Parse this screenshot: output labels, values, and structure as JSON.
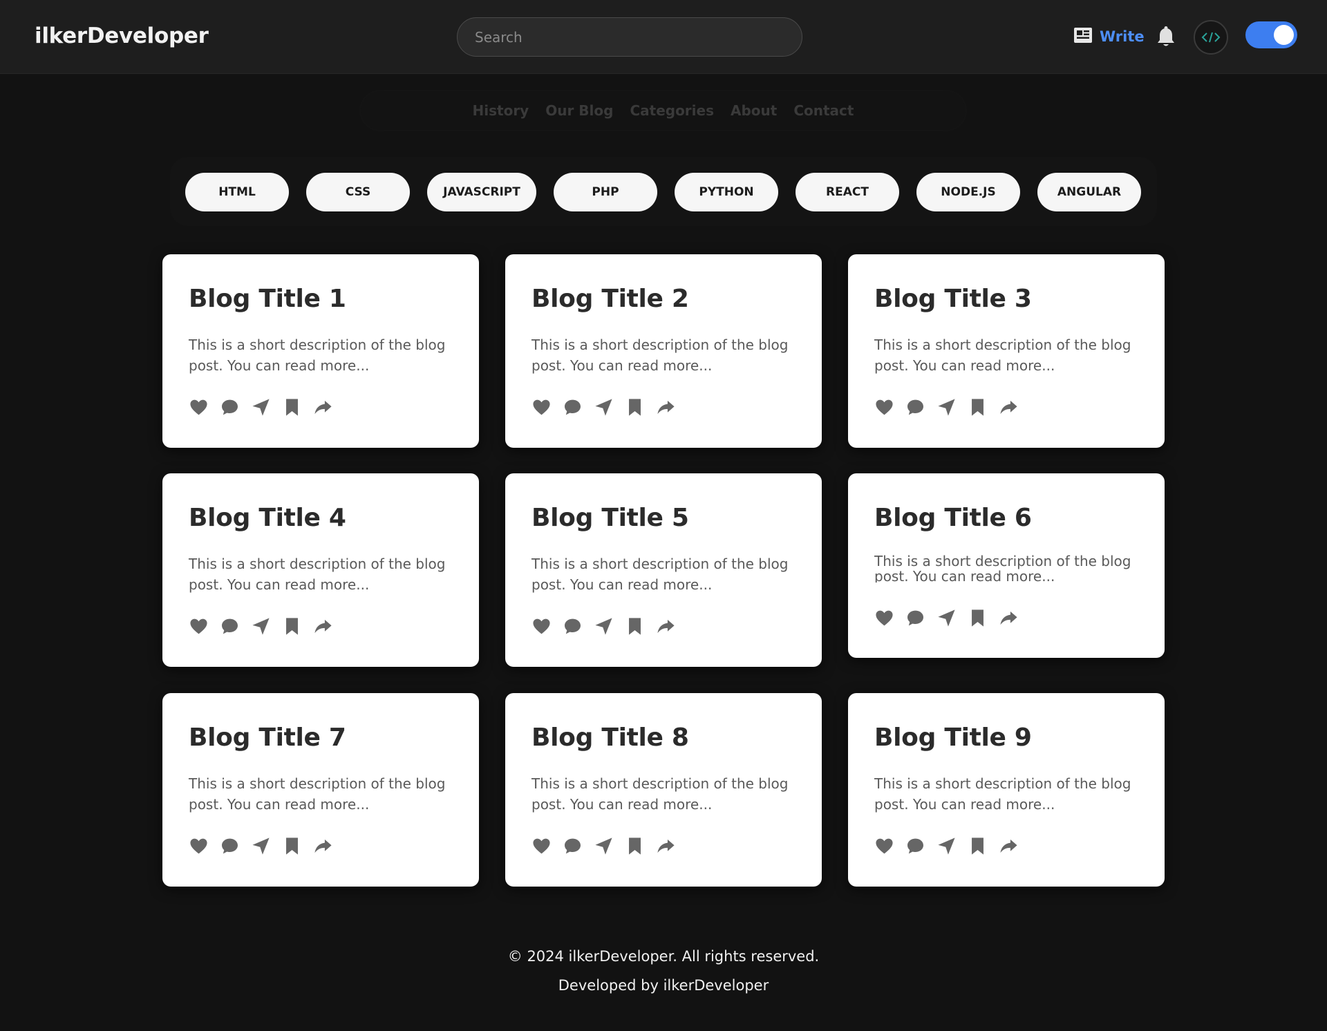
{
  "header": {
    "logo": "ilkerDeveloper",
    "search_placeholder": "Search",
    "write_label": "Write",
    "icons": {
      "write": "newspaper-icon",
      "notifications": "bell-icon",
      "avatar": "code-logo-avatar",
      "theme": "toggle-switch"
    },
    "accent_color": "#4d8ef7"
  },
  "nav": {
    "items": [
      {
        "label": "History"
      },
      {
        "label": "Our Blog"
      },
      {
        "label": "Categories"
      },
      {
        "label": "About"
      },
      {
        "label": "Contact"
      }
    ]
  },
  "tags": [
    "HTML",
    "CSS",
    "JAVASCRIPT",
    "PHP",
    "PYTHON",
    "REACT",
    "NODE.JS",
    "ANGULAR"
  ],
  "cards": [
    {
      "title": "Blog Title 1",
      "description": "This is a short description of the blog post. You can read more..."
    },
    {
      "title": "Blog Title 2",
      "description": "This is a short description of the blog post. You can read more..."
    },
    {
      "title": "Blog Title 3",
      "description": "This is a short description of the blog post. You can read more..."
    },
    {
      "title": "Blog Title 4",
      "description": "This is a short description of the blog post. You can read more..."
    },
    {
      "title": "Blog Title 5",
      "description": "This is a short description of the blog post. You can read more..."
    },
    {
      "title": "Blog Title 6",
      "description": "This is a short description of the blog post. You can read more..."
    },
    {
      "title": "Blog Title 7",
      "description": "This is a short description of the blog post. You can read more..."
    },
    {
      "title": "Blog Title 8",
      "description": "This is a short description of the blog post. You can read more..."
    },
    {
      "title": "Blog Title 9",
      "description": "This is a short description of the blog post. You can read more..."
    }
  ],
  "card_actions": [
    "heart-icon",
    "comment-icon",
    "send-icon",
    "bookmark-icon",
    "share-icon"
  ],
  "footer": {
    "copyright": "© 2024 ilkerDeveloper. All rights reserved.",
    "credit": "Developed by ilkerDeveloper"
  }
}
